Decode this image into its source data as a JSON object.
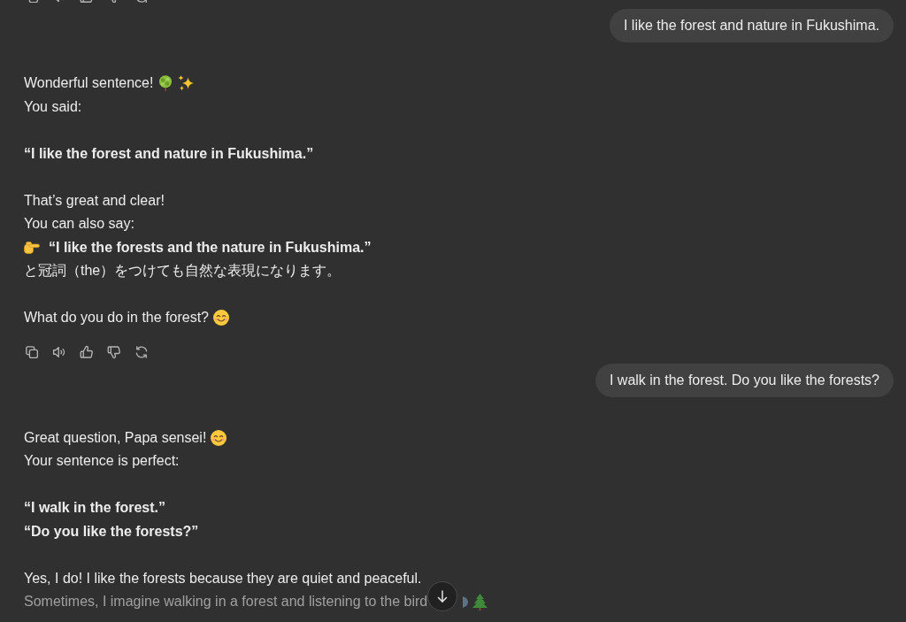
{
  "thread": [
    {
      "kind": "actions",
      "clipped": true
    },
    {
      "kind": "user",
      "text": "I like the forest and nature in Fukushima."
    },
    {
      "kind": "assistant",
      "paragraphs": [
        {
          "lines": [
            {
              "parts": [
                {
                  "kind": "text",
                  "text": "Wonderful sentence!"
                },
                {
                  "kind": "tree"
                },
                {
                  "kind": "sparkles"
                }
              ]
            },
            {
              "parts": [
                {
                  "kind": "text",
                  "text": "You said:"
                }
              ]
            }
          ]
        },
        {
          "lines": [
            {
              "parts": [
                {
                  "kind": "bold",
                  "text": "“I like the forest and nature in Fukushima.”"
                }
              ]
            }
          ]
        },
        {
          "lines": [
            {
              "parts": [
                {
                  "kind": "text",
                  "text": "That’s great and clear!"
                }
              ]
            },
            {
              "parts": [
                {
                  "kind": "text",
                  "text": "You can also say:"
                }
              ]
            },
            {
              "parts": [
                {
                  "kind": "point"
                },
                {
                  "kind": "bold",
                  "text": "“I like the forests and the nature in Fukushima.”"
                }
              ]
            },
            {
              "parts": [
                {
                  "kind": "text",
                  "text": "と冠詞（the）をつけても自然な表現になります。"
                }
              ]
            }
          ]
        },
        {
          "lines": [
            {
              "parts": [
                {
                  "kind": "text",
                  "text": "What do you do in the forest?"
                },
                {
                  "kind": "smile"
                }
              ]
            }
          ]
        }
      ]
    },
    {
      "kind": "actions",
      "clipped": false
    },
    {
      "kind": "user",
      "text": "I walk in the forest. Do you like the forests?"
    },
    {
      "kind": "assistant",
      "paragraphs": [
        {
          "lines": [
            {
              "parts": [
                {
                  "kind": "text",
                  "text": "Great question, Papa sensei!"
                },
                {
                  "kind": "smile"
                }
              ]
            },
            {
              "parts": [
                {
                  "kind": "text",
                  "text": "Your sentence is perfect:"
                }
              ]
            }
          ]
        },
        {
          "lines": [
            {
              "parts": [
                {
                  "kind": "bold",
                  "text": "“I walk in the forest.”"
                }
              ]
            },
            {
              "parts": [
                {
                  "kind": "bold",
                  "text": "“Do you like the forests?”"
                }
              ]
            }
          ]
        },
        {
          "lines": [
            {
              "parts": [
                {
                  "kind": "text",
                  "text": "Yes, I do! I like the forests because they are quiet and peaceful."
                }
              ]
            },
            {
              "parts": [
                {
                  "kind": "text",
                  "text": "Sometimes, I imagine walking in a forest and listening to the bird"
                },
                {
                  "kind": "scroll_button"
                },
                {
                  "kind": "fragment"
                },
                {
                  "kind": "pine"
                }
              ]
            }
          ]
        }
      ]
    }
  ]
}
